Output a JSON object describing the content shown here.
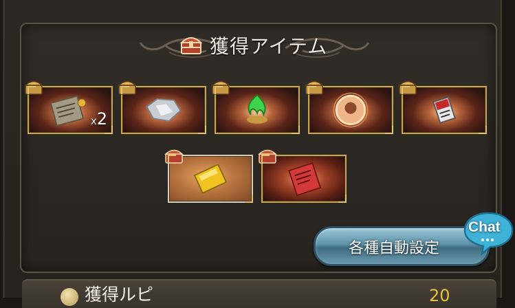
{
  "header": {
    "title": "獲得アイテム"
  },
  "items_row1": [
    {
      "name": "scroll-item",
      "qty_prefix": "x",
      "qty": "2"
    },
    {
      "name": "silver-fragment-item"
    },
    {
      "name": "green-flame-item"
    },
    {
      "name": "summon-orb-item"
    },
    {
      "name": "ticket-item"
    }
  ],
  "items_row2": [
    {
      "name": "gold-bar-item"
    },
    {
      "name": "red-scroll-item"
    }
  ],
  "auto_settings": {
    "label": "各種自動設定"
  },
  "chat": {
    "label": "Chat"
  },
  "rupi": {
    "label": "獲得ルピ",
    "value": "20"
  },
  "colors": {
    "frame_gold": "#c9a64f",
    "button_blue": "#5d92a8",
    "value_gold": "#e6c43a"
  }
}
